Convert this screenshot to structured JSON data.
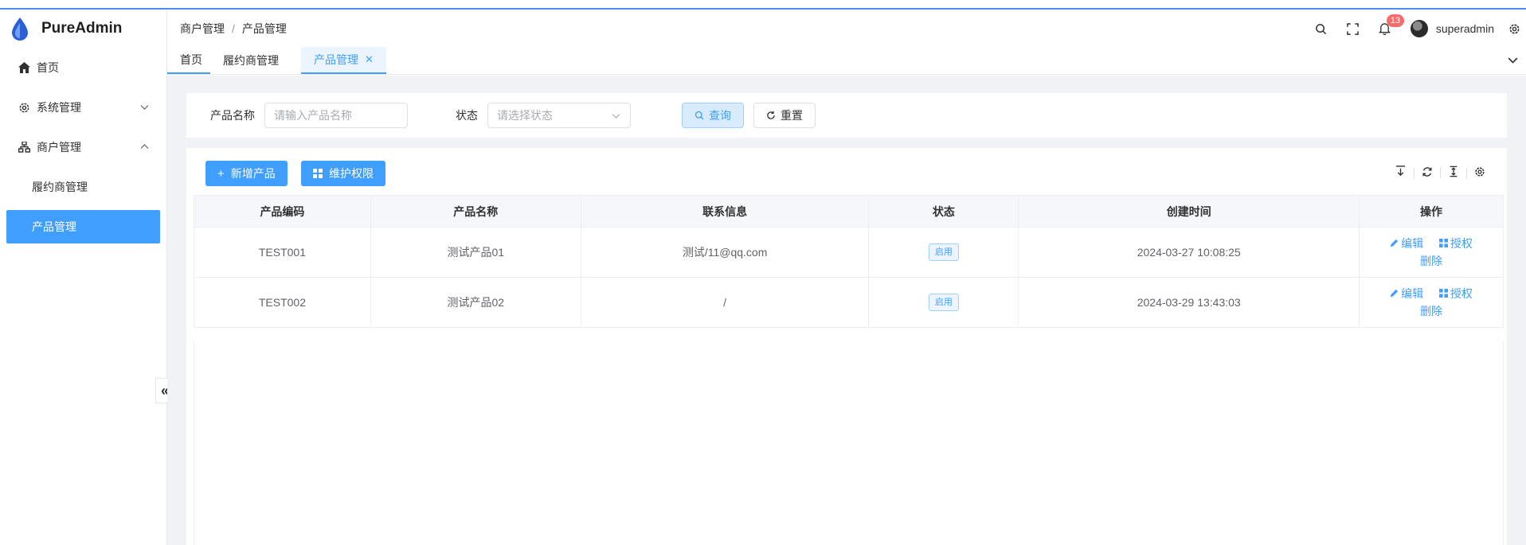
{
  "app": {
    "name": "PureAdmin"
  },
  "sidebar": {
    "items": [
      {
        "label": "首页"
      },
      {
        "label": "系统管理"
      },
      {
        "label": "商户管理"
      }
    ],
    "sub_items": [
      {
        "label": "履约商管理"
      },
      {
        "label": "产品管理"
      }
    ],
    "collapse_glyph": "«"
  },
  "header": {
    "breadcrumb": [
      "商户管理",
      "产品管理"
    ],
    "breadcrumb_sep": "/",
    "notification_count": "13",
    "username": "superadmin"
  },
  "tabs": [
    {
      "label": "首页"
    },
    {
      "label": "履约商管理"
    },
    {
      "label": "产品管理"
    }
  ],
  "search": {
    "name_label": "产品名称",
    "name_placeholder": "请输入产品名称",
    "status_label": "状态",
    "status_placeholder": "请选择状态",
    "query_label": "查询",
    "reset_label": "重置"
  },
  "toolbar": {
    "add_label": "新增产品",
    "perm_label": "维护权限"
  },
  "table": {
    "columns": [
      "产品编码",
      "产品名称",
      "联系信息",
      "状态",
      "创建时间",
      "操作"
    ],
    "rows": [
      {
        "code": "TEST001",
        "name": "测试产品01",
        "contact": "测试/11@qq.com",
        "status": "启用",
        "created": "2024-03-27 10:08:25"
      },
      {
        "code": "TEST002",
        "name": "测试产品02",
        "contact": "/",
        "status": "启用",
        "created": "2024-03-29 13:43:03"
      }
    ],
    "ops": {
      "edit": "编辑",
      "auth": "授权",
      "delete": "删除"
    }
  },
  "colors": {
    "primary": "#409eff",
    "badge": "#f56c6c"
  }
}
